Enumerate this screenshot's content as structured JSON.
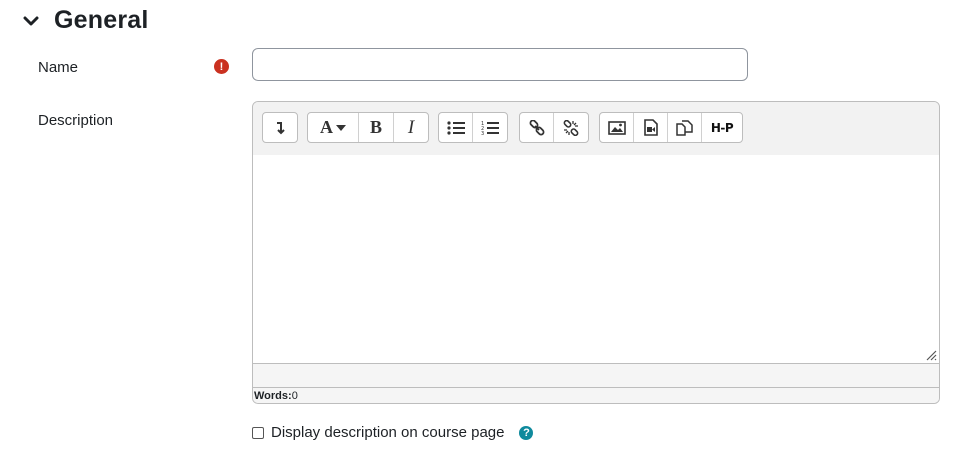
{
  "section": {
    "title": "General"
  },
  "name_field": {
    "label": "Name",
    "value": "",
    "placeholder": ""
  },
  "description": {
    "label": "Description",
    "toolbar": {
      "format": "A",
      "bold": "B",
      "italic": "I",
      "h5p": "H-P"
    },
    "status_label": "Words:",
    "word_count": "0"
  },
  "display_desc": {
    "label": "Display description on course page",
    "checked": false
  },
  "colors": {
    "required": "#ca3120",
    "help": "#0f8a9d",
    "border": "#8f959e"
  }
}
